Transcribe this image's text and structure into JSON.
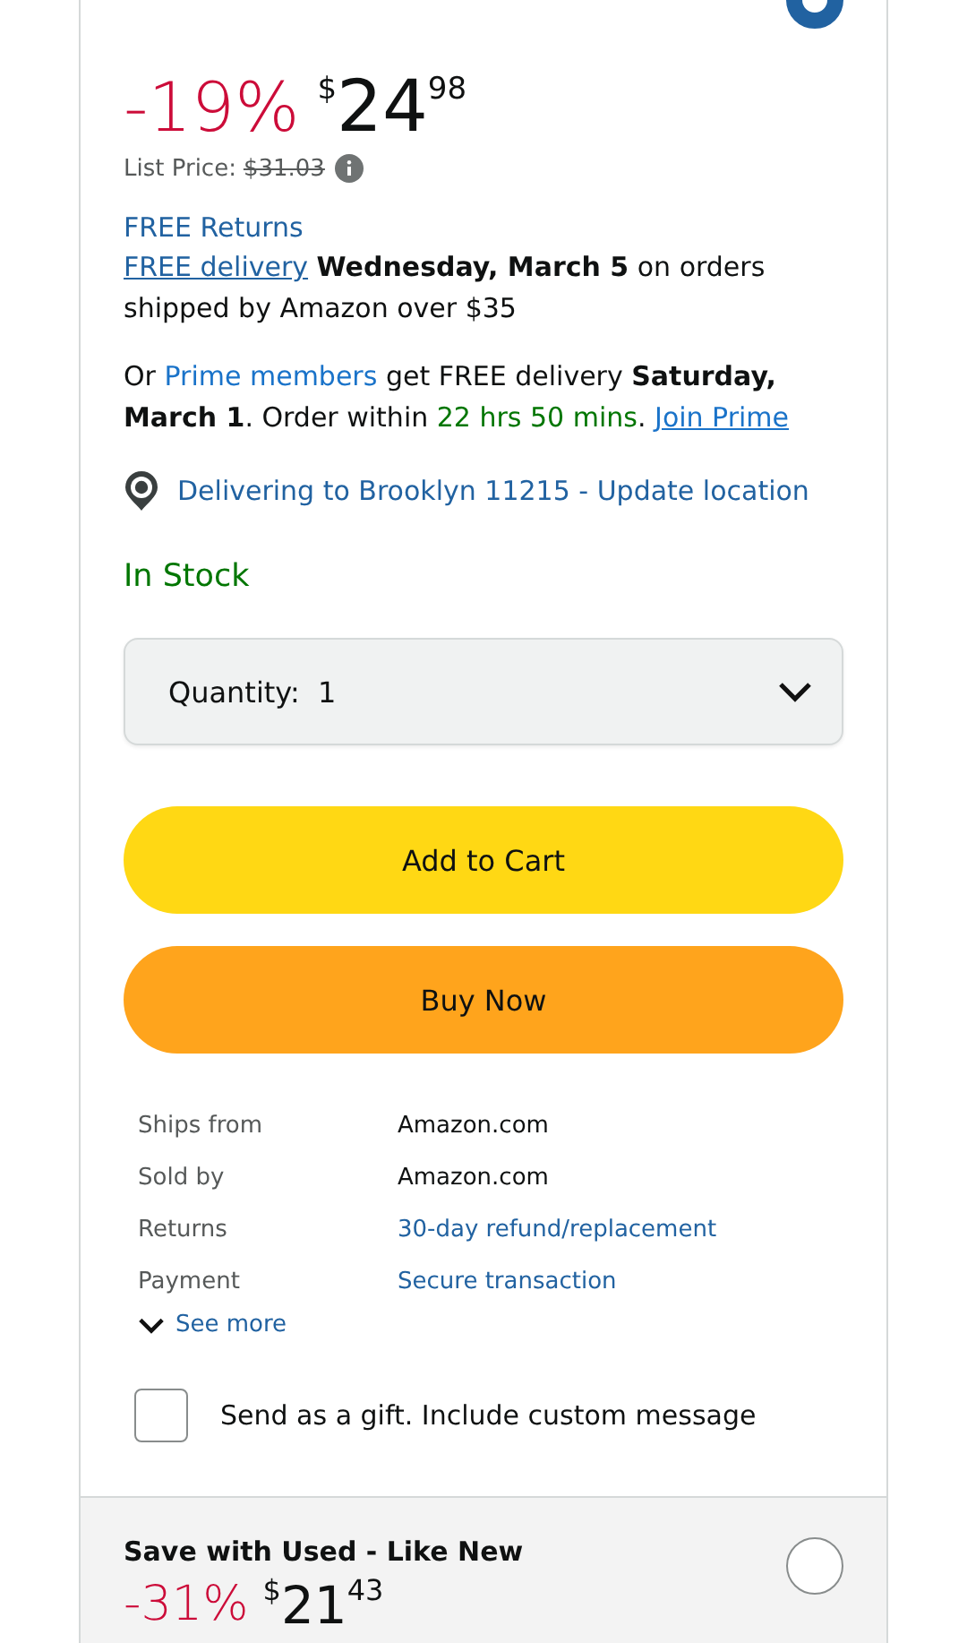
{
  "new_offer": {
    "selected": true,
    "discount": "-19%",
    "currency": "$",
    "price_whole": "24",
    "price_fraction": "98",
    "list_price_label": "List Price:",
    "list_price": "$31.03"
  },
  "returns_link": "FREE Returns",
  "delivery_message": [
    {
      "kind": "underlined_link",
      "text": "FREE delivery"
    },
    {
      "kind": "text",
      "text": " **Wednesday, March 5** on orders shipped by Amazon over $35"
    }
  ],
  "prime_message": [
    {
      "kind": "text",
      "text": "Or "
    },
    {
      "kind": "link",
      "text": "Prime members"
    },
    {
      "kind": "text",
      "text": " get FREE delivery **Saturday, March 1**. Order within "
    },
    {
      "kind": "timer",
      "text": "22 hrs 50 mins"
    },
    {
      "kind": "text",
      "text": ". "
    },
    {
      "kind": "underlined_link",
      "text": "Join Prime"
    }
  ],
  "location_link": "Delivering to Brooklyn 11215 - Update location",
  "stock_status": "In Stock",
  "quantity": {
    "label": "Quantity:",
    "value": "1"
  },
  "buttons": [
    {
      "kind": "cart",
      "label": "Add to Cart"
    },
    {
      "kind": "buy",
      "label": "Buy Now"
    }
  ],
  "details": [
    {
      "label": "Ships from",
      "value": "Amazon.com",
      "kind": "text"
    },
    {
      "label": "Sold by",
      "value": "Amazon.com",
      "kind": "text"
    },
    {
      "label": "Returns",
      "value": "30-day refund/replacement",
      "kind": "link"
    },
    {
      "label": "Payment",
      "value": "Secure transaction",
      "kind": "link"
    }
  ],
  "see_more": "See more",
  "gift": {
    "label": "Send as a gift. Include custom message",
    "checked": false
  },
  "used_offer": {
    "title": "Save with Used - Like New",
    "selected": false,
    "discount": "-31%",
    "currency": "$",
    "price_whole": "21",
    "price_fraction": "43"
  }
}
